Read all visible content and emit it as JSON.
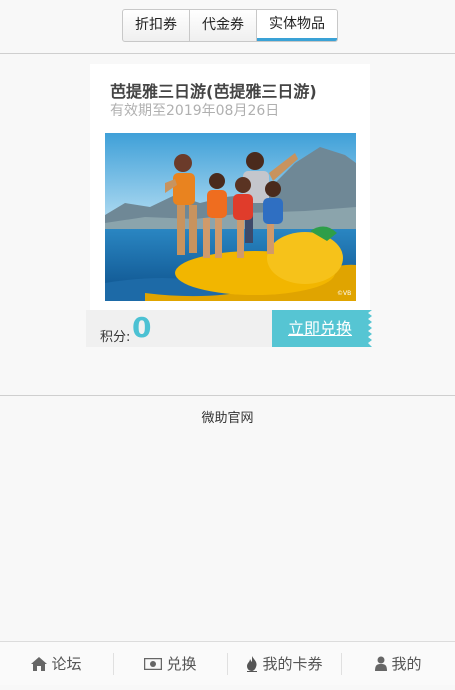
{
  "tabs": [
    {
      "label": "折扣券"
    },
    {
      "label": "代金券"
    },
    {
      "label": "实体物品"
    }
  ],
  "card": {
    "title": "芭提雅三日游(芭提雅三日游)",
    "expiry": "有效期至2019年08月26日",
    "points_label": "积分:",
    "points_value": "0",
    "redeem_label": "立即兑换"
  },
  "site_name": "微助官网",
  "footer": {
    "items": [
      {
        "label": "论坛",
        "icon": "home-icon"
      },
      {
        "label": "兑换",
        "icon": "money-icon"
      },
      {
        "label": "我的卡券",
        "icon": "flame-icon"
      },
      {
        "label": "我的",
        "icon": "user-icon"
      }
    ]
  },
  "colors": {
    "accent": "#56c5d3",
    "active_tab_underline": "#3aa2d6",
    "points_value": "#4cc1d3"
  }
}
